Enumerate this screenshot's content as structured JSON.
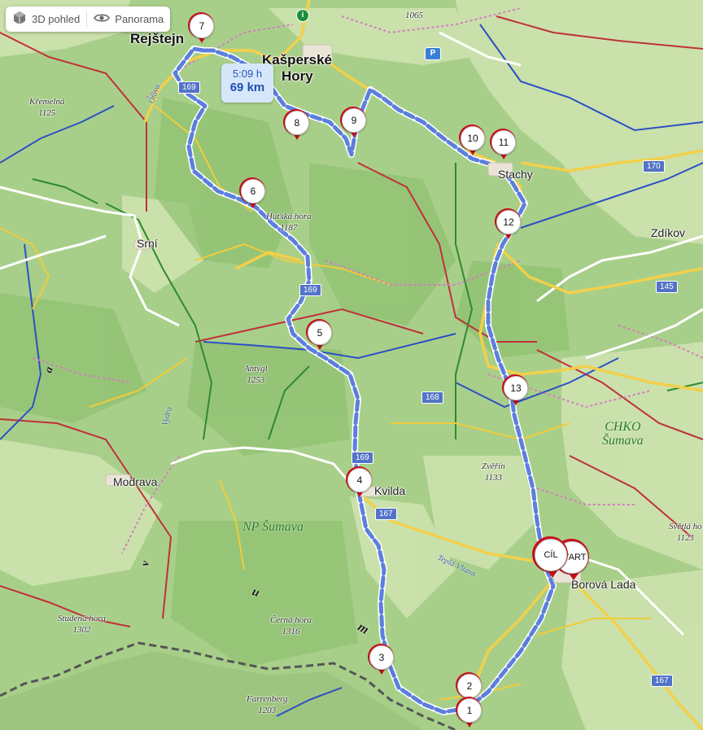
{
  "toolbar": {
    "view3d": {
      "label": "3D pohled",
      "icon": "cube-icon"
    },
    "panorama": {
      "label": "Panorama",
      "icon": "eye-icon"
    }
  },
  "route_summary": {
    "time": "5:09 h",
    "distance": "69 km"
  },
  "waypoints": {
    "w1": "1",
    "w2": "2",
    "w3": "3",
    "w4": "4",
    "w5": "5",
    "w6": "6",
    "w7": "7",
    "w8": "8",
    "w9": "9",
    "w10": "10",
    "w11": "11",
    "w12": "12",
    "w13": "13",
    "finish": "CÍL",
    "start": "START"
  },
  "towns": {
    "rejstejn": "Rejštejn",
    "kasperske_l1": "Kašperské",
    "kasperske_l2": "Hory",
    "srni": "Srní",
    "stachy": "Stachy",
    "zdikov": "Zdíkov",
    "modrava": "Modrava",
    "kvilda": "Kvilda",
    "borova_lada": "Borová Lada"
  },
  "peaks": {
    "kremelna": {
      "name": "Křemelná",
      "elev": "1125"
    },
    "hutska": {
      "name": "Huťská hora",
      "elev": "1187"
    },
    "antygl": {
      "name": "Antýgl",
      "elev": "1253"
    },
    "zverin": {
      "name": "Zvěřín",
      "elev": "1133"
    },
    "studena": {
      "name": "Studená hora",
      "elev": "1302"
    },
    "cerna": {
      "name": "Černá hora",
      "elev": "1316"
    },
    "farrenberg": {
      "name": "Farrenberg",
      "elev": "1203"
    },
    "svetla": {
      "name": "Světlá ho",
      "elev": "1123"
    },
    "top1065": {
      "elev": "1065"
    }
  },
  "areas": {
    "np": "NP Šumava",
    "chko_l1": "CHKO",
    "chko_l2": "Šumava",
    "sumava_letters": {
      "a": "a",
      "u": "u",
      "m": "m",
      "v": "v"
    }
  },
  "rivers": {
    "otava": "Otava",
    "vydra": "Vydra",
    "tepla_vltava": "Teplá Vltava"
  },
  "roads": {
    "r169a": "169",
    "r169b": "169",
    "r169c": "169",
    "r168": "168",
    "r167a": "167",
    "r167b": "167",
    "r170": "170",
    "r145": "145"
  },
  "colors": {
    "map_bg": "#a9cf8c",
    "forest": "#9cc97d",
    "meadow": "#cfe3b0",
    "route": "#5b7fdc",
    "pin_red": "#c8101a",
    "bubble": "#d7e7fb",
    "road_yellow": "#f2d04a",
    "trail_red": "#c0303a",
    "trail_blue": "#2d4fc4",
    "trail_green": "#2e8a2e",
    "border": "#555555"
  }
}
